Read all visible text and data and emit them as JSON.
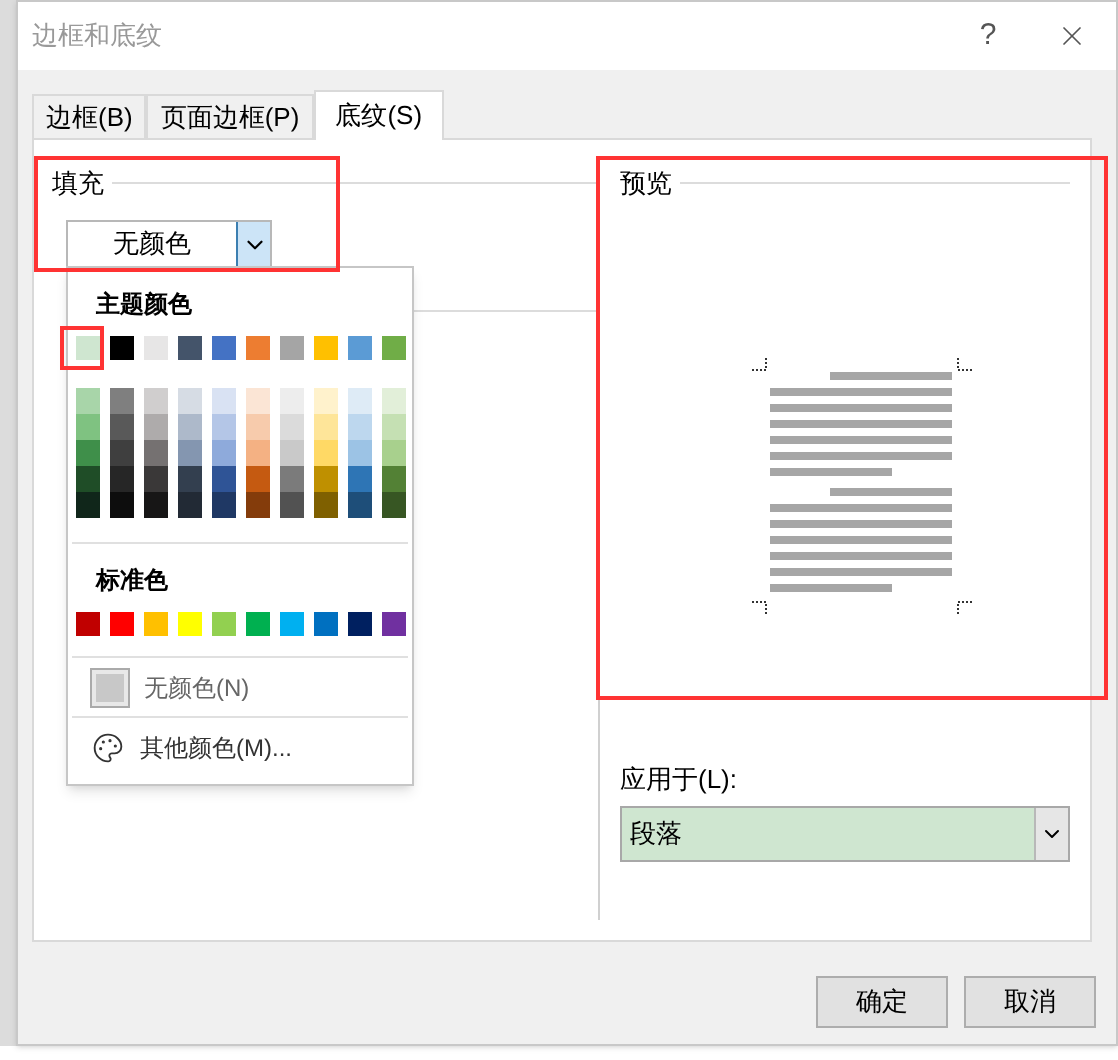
{
  "window": {
    "title": "边框和底纹",
    "help": "?"
  },
  "tabs": [
    {
      "label": "边框(B)",
      "selected": false
    },
    {
      "label": "页面边框(P)",
      "selected": false
    },
    {
      "label": "底纹(S)",
      "selected": true
    }
  ],
  "fill": {
    "legend": "填充",
    "value": "无颜色"
  },
  "color_menu": {
    "theme_heading": "主题颜色",
    "theme_colors": [
      {
        "color": "#cfe6d0"
      },
      {
        "color": "#000000"
      },
      {
        "color": "#e7e6e6"
      },
      {
        "color": "#44546a"
      },
      {
        "color": "#4472c4"
      },
      {
        "color": "#ed7d31"
      },
      {
        "color": "#a5a5a5"
      },
      {
        "color": "#ffc000"
      },
      {
        "color": "#5b9bd5"
      },
      {
        "color": "#70ad47"
      }
    ],
    "shades": [
      {
        "tints": [
          {
            "color": "#a8d5a9"
          },
          {
            "color": "#7fc281"
          },
          {
            "color": "#3f8f4a"
          },
          {
            "color": "#1f4d27"
          },
          {
            "color": "#10261a"
          }
        ]
      },
      {
        "tints": [
          {
            "color": "#7f7f7f"
          },
          {
            "color": "#595959"
          },
          {
            "color": "#3f3f3f"
          },
          {
            "color": "#262626"
          },
          {
            "color": "#0d0d0d"
          }
        ]
      },
      {
        "tints": [
          {
            "color": "#d0cece"
          },
          {
            "color": "#aeabab"
          },
          {
            "color": "#757171"
          },
          {
            "color": "#3a3838"
          },
          {
            "color": "#171616"
          }
        ]
      },
      {
        "tints": [
          {
            "color": "#d6dce4"
          },
          {
            "color": "#adb9ca"
          },
          {
            "color": "#8496b0"
          },
          {
            "color": "#333f4f"
          },
          {
            "color": "#222a35"
          }
        ]
      },
      {
        "tints": [
          {
            "color": "#d9e2f3"
          },
          {
            "color": "#b4c6e7"
          },
          {
            "color": "#8eaadb"
          },
          {
            "color": "#2f5496"
          },
          {
            "color": "#1f3864"
          }
        ]
      },
      {
        "tints": [
          {
            "color": "#fbe5d5"
          },
          {
            "color": "#f7cbac"
          },
          {
            "color": "#f4b183"
          },
          {
            "color": "#c55a11"
          },
          {
            "color": "#843c0b"
          }
        ]
      },
      {
        "tints": [
          {
            "color": "#ededed"
          },
          {
            "color": "#dbdbdb"
          },
          {
            "color": "#c9c9c9"
          },
          {
            "color": "#7b7b7b"
          },
          {
            "color": "#525252"
          }
        ]
      },
      {
        "tints": [
          {
            "color": "#fff2cc"
          },
          {
            "color": "#fee599"
          },
          {
            "color": "#ffd965"
          },
          {
            "color": "#bf9000"
          },
          {
            "color": "#7f6000"
          }
        ]
      },
      {
        "tints": [
          {
            "color": "#deebf6"
          },
          {
            "color": "#bdd7ee"
          },
          {
            "color": "#9cc3e5"
          },
          {
            "color": "#2e75b5"
          },
          {
            "color": "#1e4e79"
          }
        ]
      },
      {
        "tints": [
          {
            "color": "#e2efd9"
          },
          {
            "color": "#c5e0b3"
          },
          {
            "color": "#a8d08d"
          },
          {
            "color": "#538135"
          },
          {
            "color": "#375623"
          }
        ]
      }
    ],
    "standard_heading": "标准色",
    "standard_colors": [
      {
        "color": "#c00000"
      },
      {
        "color": "#ff0000"
      },
      {
        "color": "#ffc000"
      },
      {
        "color": "#ffff00"
      },
      {
        "color": "#92d050"
      },
      {
        "color": "#00b050"
      },
      {
        "color": "#00b0f0"
      },
      {
        "color": "#0070c0"
      },
      {
        "color": "#002060"
      },
      {
        "color": "#7030a0"
      }
    ],
    "no_color": "无颜色(N)",
    "more_colors": "其他颜色(M)..."
  },
  "preview": {
    "legend": "预览"
  },
  "apply_to": {
    "label": "应用于(L):",
    "value": "段落"
  },
  "buttons": [
    "确定",
    "取消"
  ]
}
